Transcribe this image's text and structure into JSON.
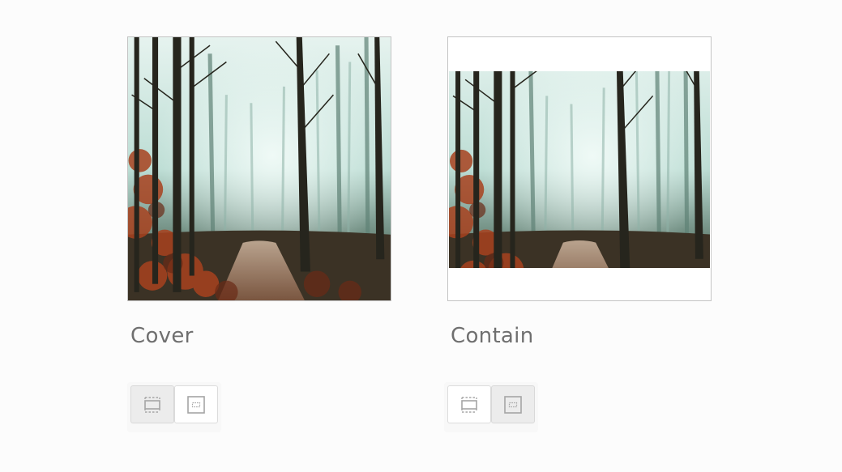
{
  "panels": {
    "cover": {
      "label": "Cover",
      "image_name": "misty-forest-photo",
      "fit": "cover",
      "toolbar": {
        "active": "cover-fit"
      }
    },
    "contain": {
      "label": "Contain",
      "image_name": "misty-forest-photo",
      "fit": "contain",
      "toolbar": {
        "active": "contain-fit"
      }
    }
  },
  "toolbar": {
    "buttons": [
      {
        "id": "cover-fit",
        "icon": "crop-frame-icon"
      },
      {
        "id": "contain-fit",
        "icon": "fit-frame-icon"
      }
    ]
  },
  "colors": {
    "label": "#6f6f6f",
    "border": "#c4c4c4",
    "active_button": "#ececec",
    "fog": "#cfe6e0",
    "trunk": "#2a2a22",
    "leaves": "#a8421f"
  }
}
